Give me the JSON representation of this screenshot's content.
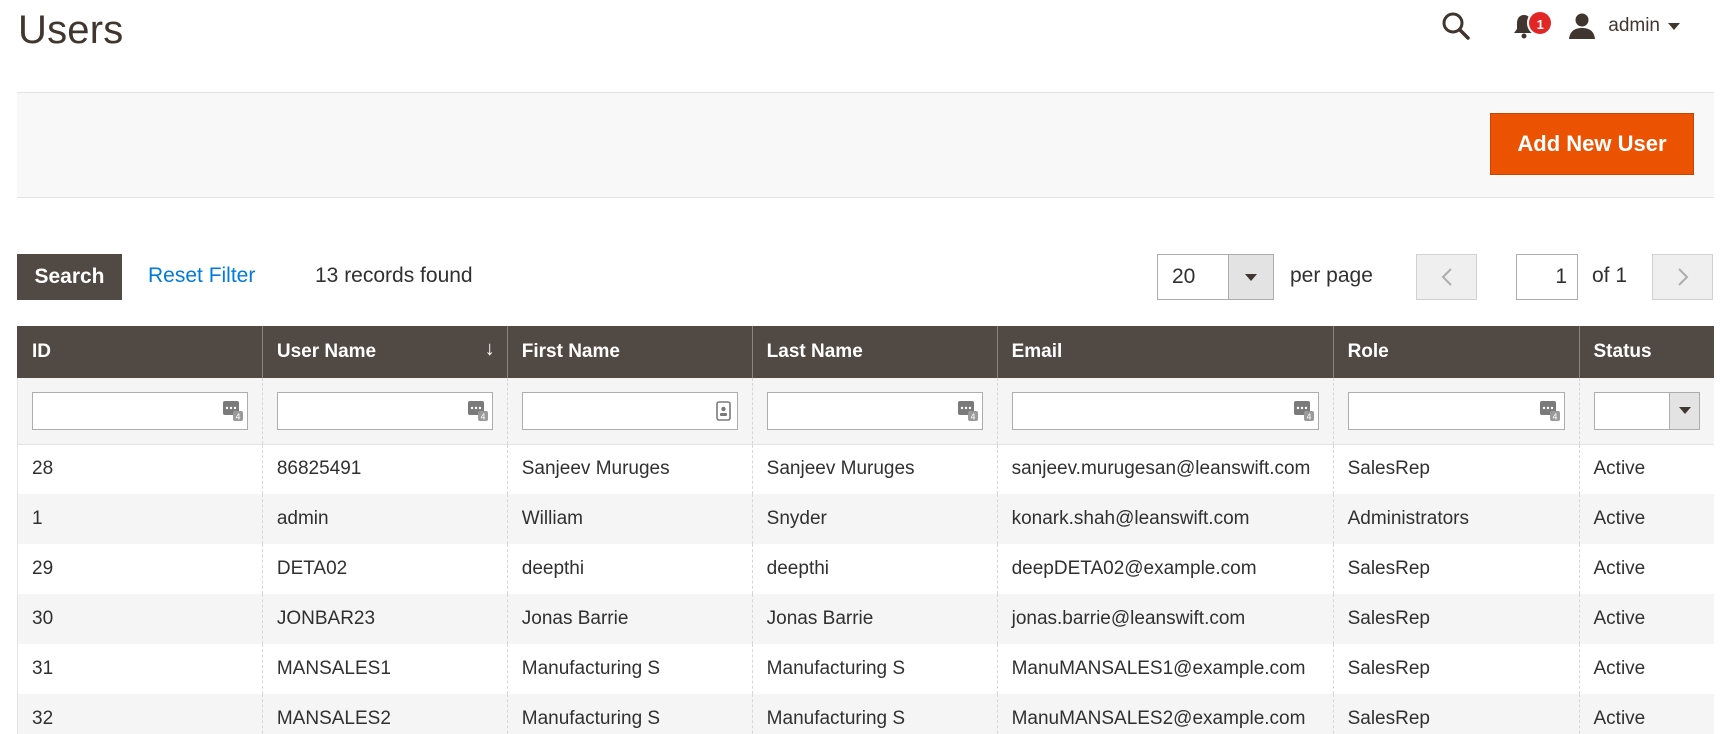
{
  "page_title": "Users",
  "header": {
    "notification_count": "1",
    "user_name": "admin"
  },
  "actions": {
    "add_new_user": "Add New User"
  },
  "toolbar": {
    "search_label": "Search",
    "reset_filter_label": "Reset Filter",
    "records_found": "13 records found",
    "per_page_value": "20",
    "per_page_label": "per page",
    "current_page": "1",
    "total_pages": "of 1"
  },
  "columns": [
    "ID",
    "User Name",
    "First Name",
    "Last Name",
    "Email",
    "Role",
    "Status"
  ],
  "sort_indicator": "↓",
  "rows": [
    [
      "28",
      "86825491",
      "Sanjeev Muruges",
      "Sanjeev Muruges",
      "sanjeev.murugesan@leanswift.com",
      "SalesRep",
      "Active"
    ],
    [
      "1",
      "admin",
      "William",
      "Snyder",
      "konark.shah@leanswift.com",
      "Administrators",
      "Active"
    ],
    [
      "29",
      "DETA02",
      "deepthi",
      "deepthi",
      "deepDETA02@example.com",
      "SalesRep",
      "Active"
    ],
    [
      "30",
      "JONBAR23",
      "Jonas Barrie",
      "Jonas Barrie",
      "jonas.barrie@leanswift.com",
      "SalesRep",
      "Active"
    ],
    [
      "31",
      "MANSALES1",
      "Manufacturing S",
      "Manufacturing S",
      "ManuMANSALES1@example.com",
      "SalesRep",
      "Active"
    ],
    [
      "32",
      "MANSALES2",
      "Manufacturing S",
      "Manufacturing S",
      "ManuMANSALES2@example.com",
      "SalesRep",
      "Active"
    ]
  ],
  "colors": {
    "accent": "#eb5202",
    "header_bg": "#514943",
    "link": "#007bdb",
    "badge": "#e22626"
  }
}
